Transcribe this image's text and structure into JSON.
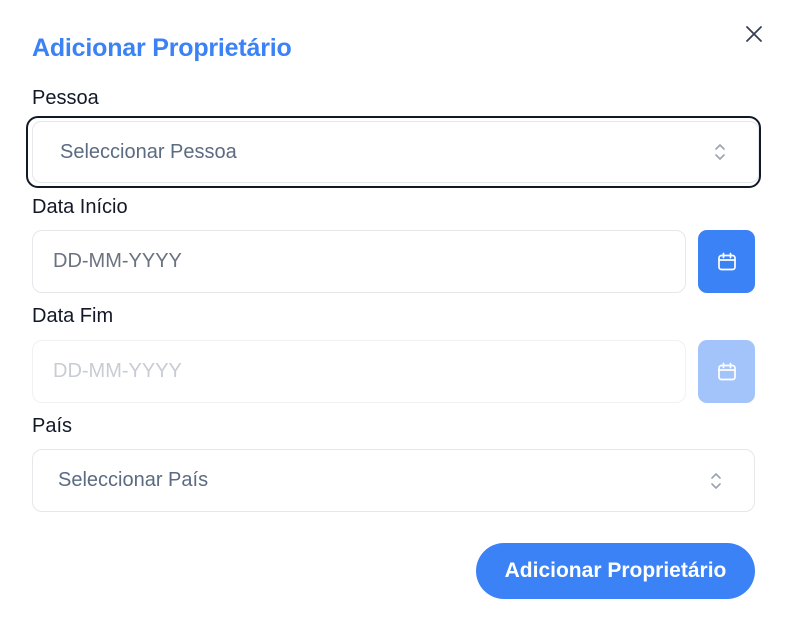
{
  "dialog": {
    "title": "Adicionar Proprietário",
    "close_icon": "close-icon"
  },
  "form": {
    "pessoa": {
      "label": "Pessoa",
      "placeholder": "Seleccionar Pessoa",
      "icon": "chevron-up-down-icon"
    },
    "data_inicio": {
      "label": "Data Início",
      "placeholder": "DD-MM-YYYY",
      "icon": "calendar-icon"
    },
    "data_fim": {
      "label": "Data Fim",
      "placeholder": "DD-MM-YYYY",
      "icon": "calendar-icon",
      "disabled": true
    },
    "pais": {
      "label": "País",
      "placeholder": "Seleccionar País",
      "icon": "chevron-up-down-icon"
    }
  },
  "actions": {
    "submit_label": "Adicionar Proprietário"
  },
  "colors": {
    "accent": "#3b82f6",
    "accent_disabled": "#a3c4fb",
    "focus_ring": "#111827"
  }
}
